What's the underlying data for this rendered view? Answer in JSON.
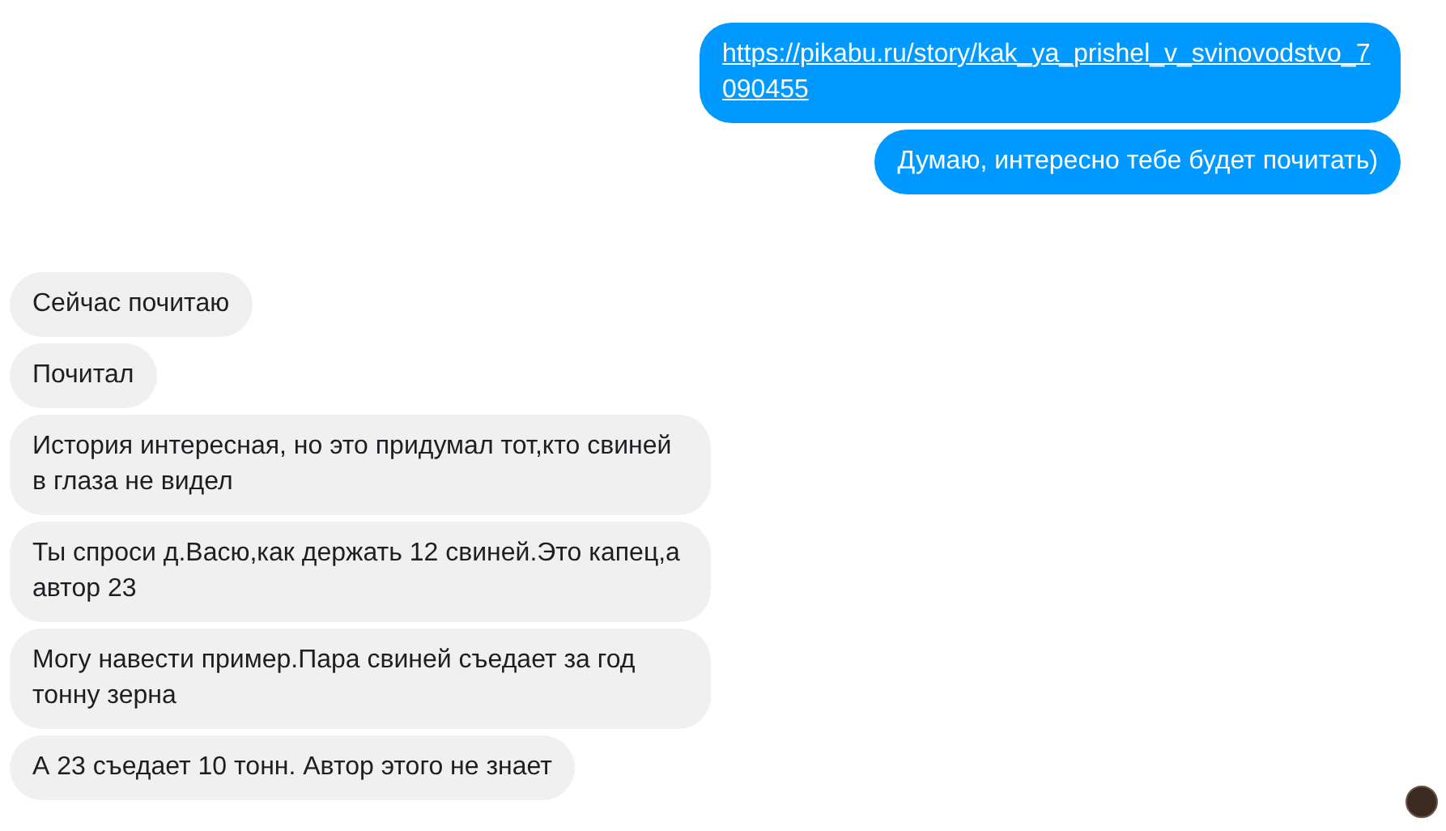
{
  "messages": [
    {
      "kind": "outgoing",
      "link": true,
      "text": "https://pikabu.ru/story/kak_ya_prishel_v_svinovodstvo_7090455"
    },
    {
      "kind": "outgoing",
      "link": false,
      "text": "Думаю, интересно тебе будет почитать)"
    },
    {
      "kind": "incoming",
      "link": false,
      "text": "Сейчас почитаю"
    },
    {
      "kind": "incoming",
      "link": false,
      "text": "Почитал"
    },
    {
      "kind": "incoming",
      "link": false,
      "text": "История интересная, но это придумал тот,кто свиней в глаза не видел"
    },
    {
      "kind": "incoming",
      "link": false,
      "text": "Ты спроси д.Васю,как держать 12 свиней.Это капец,а автор 23"
    },
    {
      "kind": "incoming",
      "link": false,
      "text": "Могу навести пример.Пара свиней съедает за год тонну зерна"
    },
    {
      "kind": "incoming",
      "link": false,
      "text": "А 23 съедает 10 тонн. Автор этого не знает"
    }
  ],
  "read_receipt": {
    "seen": true
  }
}
